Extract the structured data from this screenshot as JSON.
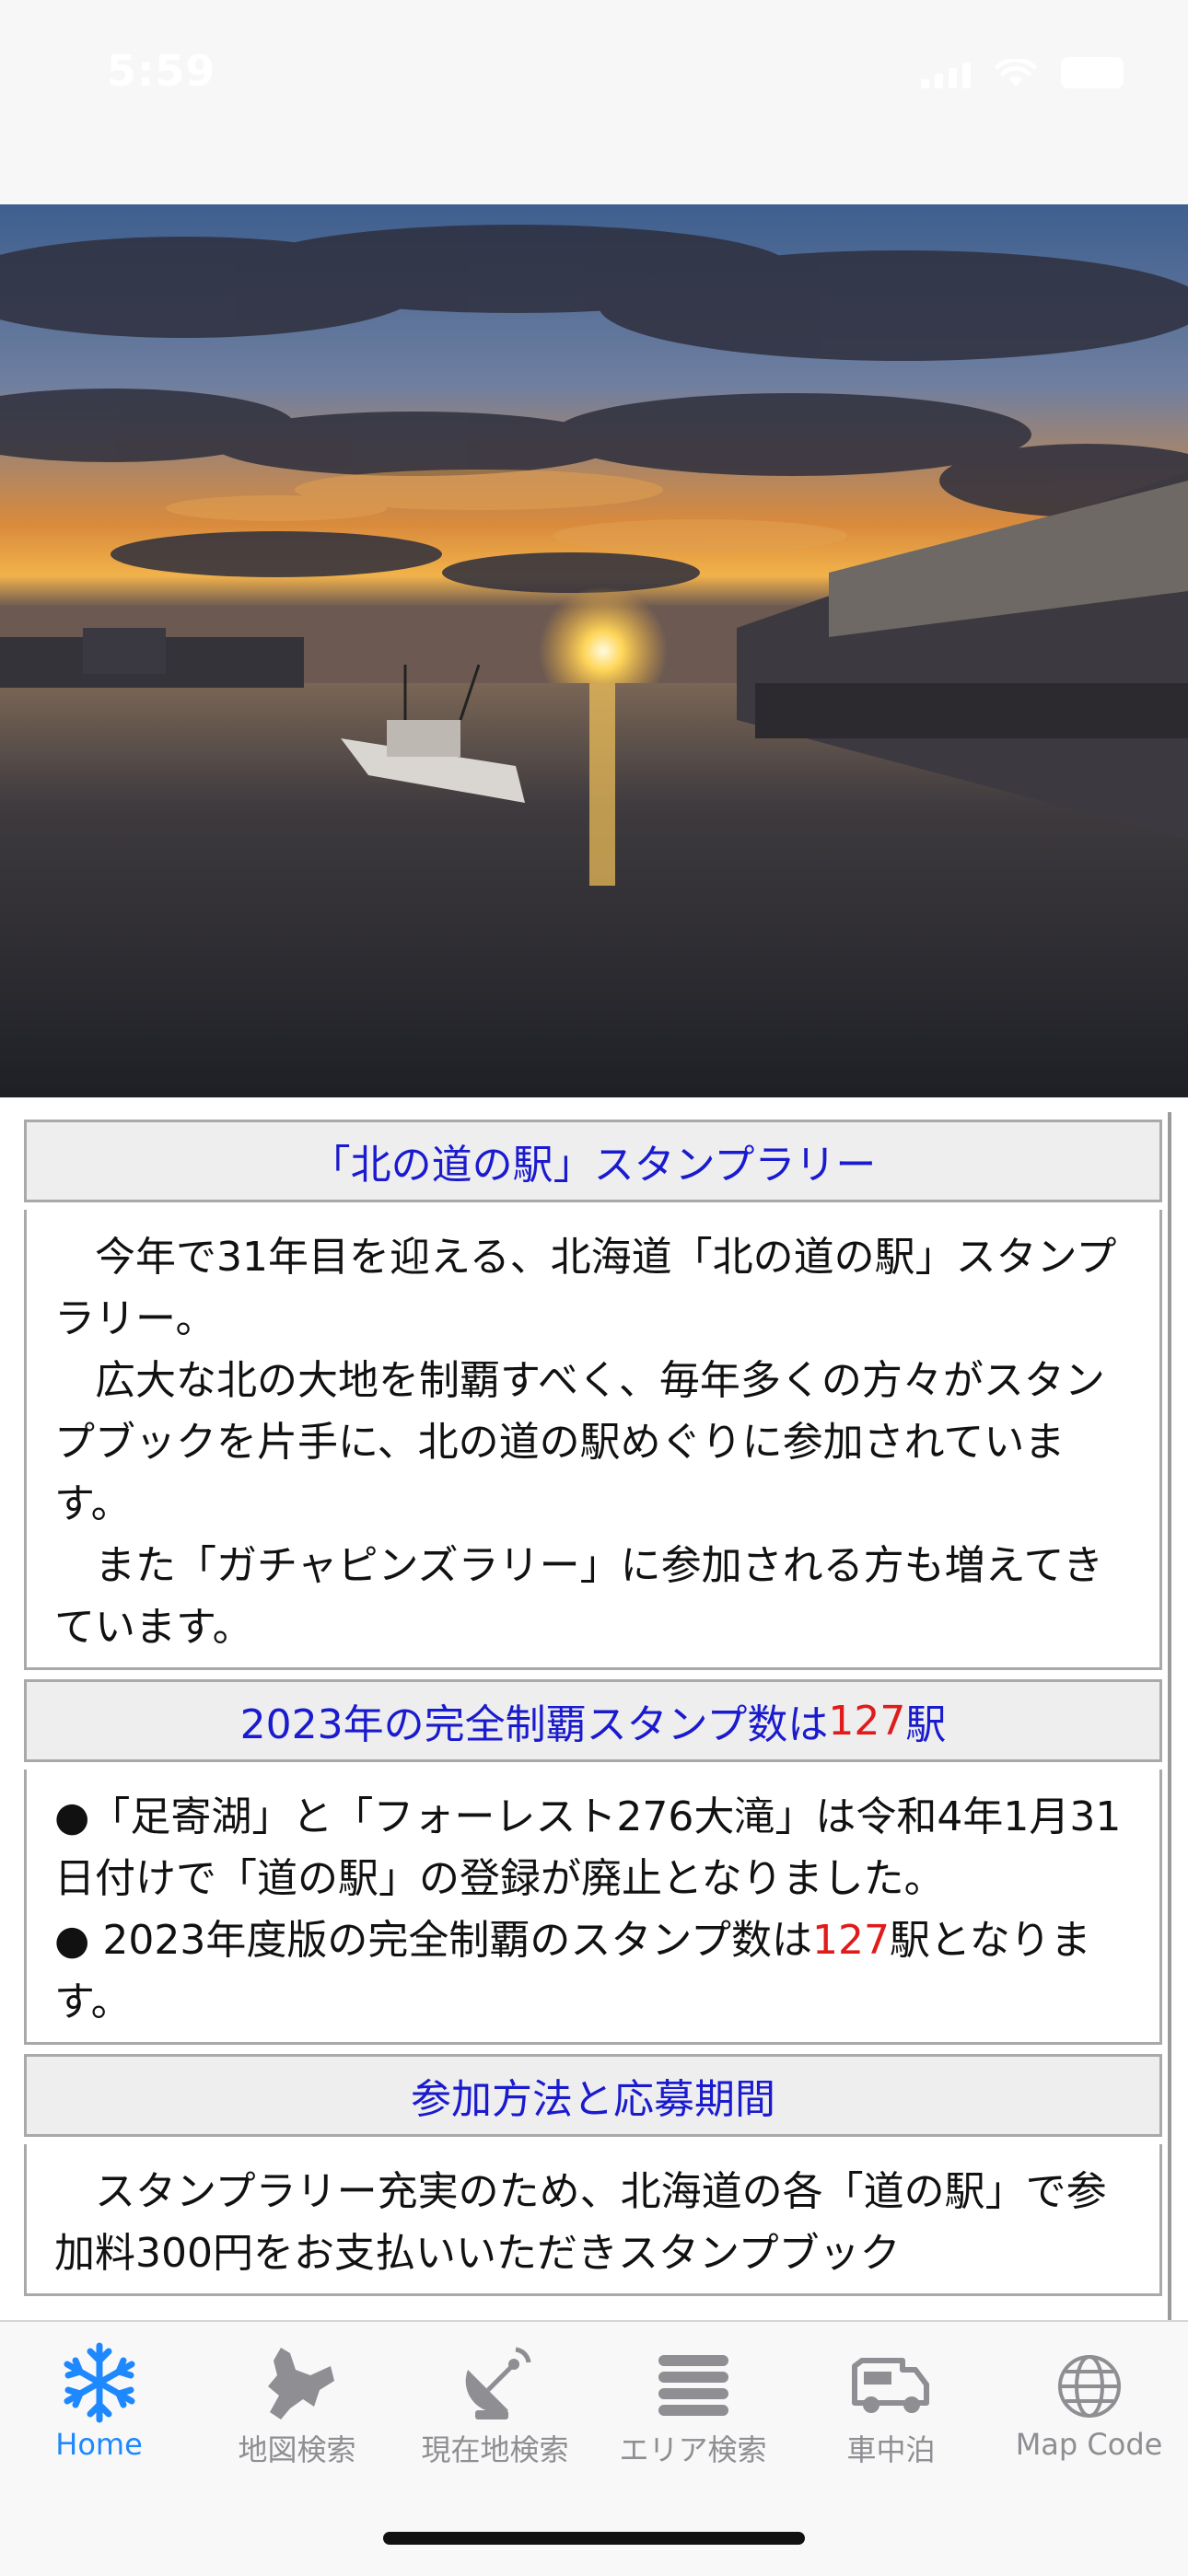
{
  "status": {
    "time": "5:59"
  },
  "hero": {
    "alt_icon": "harbor-sunset-photo"
  },
  "sections": [
    {
      "title": "「北の道の駅」スタンプラリー",
      "paragraphs": [
        "今年で31年目を迎える、北海道「北の道の駅」スタンプラリー。",
        "広大な北の大地を制覇すべく、毎年多くの方々がスタンプブックを片手に、北の道の駅めぐりに参加されています。",
        "また「ガチャピンズラリー」に参加される方も増えてきています。"
      ]
    },
    {
      "title_prefix": "2023年の完全制覇スタンプ数は",
      "title_count": "127",
      "title_suffix": "駅",
      "bullet1": "●「足寄湖」と「フォーレスト276大滝」は令和4年1月31日付けで「道の駅」の登録が廃止となりました。",
      "bullet2_prefix": "● 2023年度版の完全制覇のスタンプ数は",
      "bullet2_count": "127",
      "bullet2_suffix": "駅となります。"
    },
    {
      "title": "参加方法と応募期間",
      "paragraph": "スタンプラリー充実のため、北海道の各「道の駅」で参加料300円をお支払いいただきスタンプブック"
    }
  ],
  "tabs": [
    {
      "label": "Home",
      "icon": "snowflake-icon",
      "active": true
    },
    {
      "label": "地図検索",
      "icon": "hokkaido-map-icon",
      "active": false
    },
    {
      "label": "現在地検索",
      "icon": "satellite-dish-icon",
      "active": false
    },
    {
      "label": "エリア検索",
      "icon": "list-lines-icon",
      "active": false
    },
    {
      "label": "車中泊",
      "icon": "camper-van-icon",
      "active": false
    },
    {
      "label": "Map Code",
      "icon": "globe-icon",
      "active": false
    }
  ],
  "colors": {
    "accent": "#1e88ff",
    "heading": "#1a1acf",
    "highlight": "#e11a1a"
  }
}
